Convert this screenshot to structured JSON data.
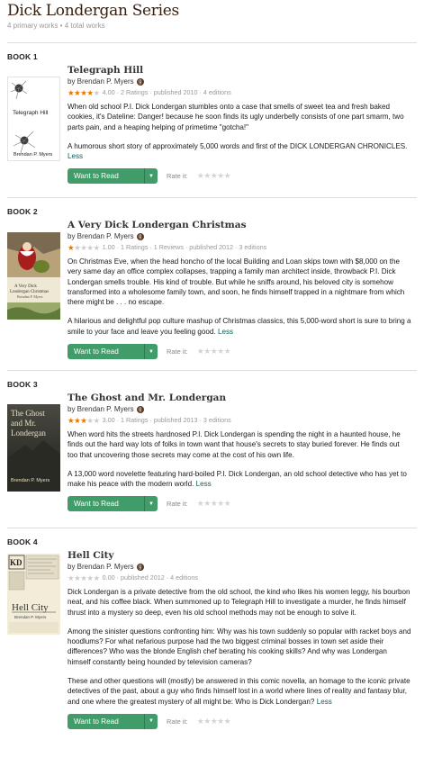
{
  "series": {
    "title": "Dick Londergan Series",
    "subtitle": "4 primary works • 4 total works"
  },
  "labels": {
    "want_to_read": "Want to Read",
    "rate_it": "Rate it:",
    "less": "Less"
  },
  "colors": {
    "title_brown": "#382110",
    "star_orange": "#e87400",
    "button_green": "#409d69",
    "link_teal": "#00635d"
  },
  "icons": {
    "author_badge": "goodreads-author-badge-icon",
    "dropdown": "caret-down-icon",
    "star": "star-icon"
  },
  "books": [
    {
      "label": "BOOK 1",
      "title": "Telegraph Hill",
      "author": "by Brendan P. Myers",
      "rating_value": 4.0,
      "stats": "4.00 · 2 Ratings · published 2010 · 4 editions",
      "cover_text": [
        "Telegraph Hill",
        "Brendan P. Myers"
      ],
      "paragraphs": [
        "When old school P.I. Dick Londergan stumbles onto a case that smells of sweet tea and fresh baked cookies, it's Dateline: Danger! because he soon finds its ugly underbelly consists of one part smarm, two parts pain, and a heaping helping of primetime \"gotcha!\"",
        "A humorous short story of approximately 5,000 words and first of the DICK LONDERGAN CHRONICLES."
      ]
    },
    {
      "label": "BOOK 2",
      "title": "A Very Dick Londergan Christmas",
      "author": "by Brendan P. Myers",
      "rating_value": 1.0,
      "stats": "1.00 · 1 Ratings · 1 Reviews · published 2012 · 3 editions",
      "cover_text": [
        "A Very Dick",
        "Londergan Christmas",
        "Brendan P. Myers"
      ],
      "paragraphs": [
        "On Christmas Eve, when the head honcho of the local Building and Loan skips town with $8,000 on the very same day an office complex collapses, trapping a family man architect inside, throwback P.I. Dick Londergan smells trouble. His kind of trouble. But while he sniffs around, his beloved city is somehow transformed into a wholesome family town, and soon, he finds himself trapped in a nightmare from which there might be . . . no escape.",
        "A hilarious and delightful pop culture mashup of Christmas classics, this 5,000-word short is sure to bring a smile to your face and leave you feeling good."
      ]
    },
    {
      "label": "BOOK 3",
      "title": "The Ghost and Mr. Londergan",
      "author": "by Brendan P. Myers",
      "rating_value": 3.0,
      "stats": "3.00 · 1 Ratings · published 2013 · 3 editions",
      "cover_text": [
        "The Ghost",
        "and Mr.",
        "Londergan",
        "Brendan P. Myers"
      ],
      "paragraphs": [
        "When word hits the streets hardnosed P.I. Dick Londergan is spending the night in a haunted house, he finds out the hard way lots of folks in town want that house's secrets to stay buried forever. He finds out too that uncovering those secrets may come at the cost of his own life.",
        "A 13,000 word novelette featuring hard-boiled P.I. Dick Londergan, an old school detective who has yet to make his peace with the modern world."
      ]
    },
    {
      "label": "BOOK 4",
      "title": "Hell City",
      "author": "by Brendan P. Myers",
      "rating_value": 0.0,
      "stats": "0.00 · published 2012 · 4 editions",
      "cover_text": [
        "KD",
        "Hell City",
        "Brendan P. Myers"
      ],
      "paragraphs": [
        "Dick Londergan is a private detective from the old school, the kind who likes his women leggy, his bourbon neat, and his coffee black. When summoned up to Telegraph Hill to investigate a murder, he finds himself thrust into a mystery so deep, even his old school methods may not be enough to solve it.",
        "Among the sinister questions confronting him: Why was his town suddenly so popular with racket boys and hoodlums? For what nefarious purpose had the two biggest criminal bosses in town set aside their differences? Who was the blonde English chef berating his cooking skills? And why was Londergan himself constantly being hounded by television cameras?",
        "These and other questions will (mostly) be answered in this comic novella, an homage to the iconic private detectives of the past, about a guy who finds himself lost in a world where lines of reality and fantasy blur, and one where the greatest mystery of all might be: Who is Dick Londergan?"
      ]
    }
  ]
}
